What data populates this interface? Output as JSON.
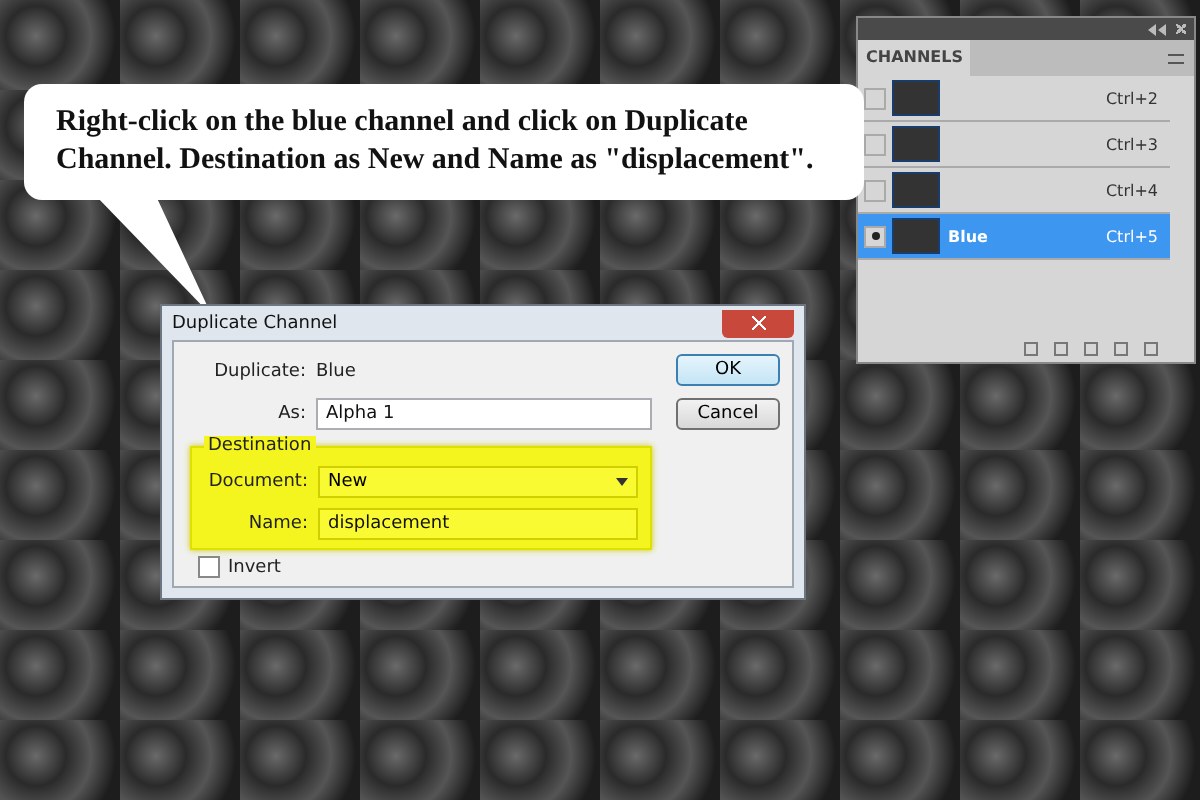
{
  "callout": {
    "text": "Right-click on the blue channel and click on Duplicate Channel. Destination as New and Name as \"displacement\"."
  },
  "channels_panel": {
    "title": "CHANNELS",
    "rows": [
      {
        "shortcut": "Ctrl+2",
        "selected": false,
        "visible": false
      },
      {
        "shortcut": "Ctrl+3",
        "selected": false,
        "visible": false
      },
      {
        "shortcut": "Ctrl+4",
        "selected": false,
        "visible": false
      },
      {
        "name": "Blue",
        "shortcut": "Ctrl+5",
        "selected": true,
        "visible": true
      }
    ]
  },
  "dialog": {
    "title": "Duplicate Channel",
    "duplicate_label": "Duplicate:",
    "duplicate_value": "Blue",
    "as_label": "As:",
    "as_value": "Alpha 1",
    "destination": {
      "title": "Destination",
      "highlighted": true,
      "document_label": "Document:",
      "document_value": "New",
      "name_label": "Name:",
      "name_value": "displacement"
    },
    "invert": {
      "label": "Invert",
      "checked": false
    },
    "buttons": [
      {
        "label": "OK",
        "default": true
      },
      {
        "label": "Cancel",
        "default": false
      }
    ]
  }
}
